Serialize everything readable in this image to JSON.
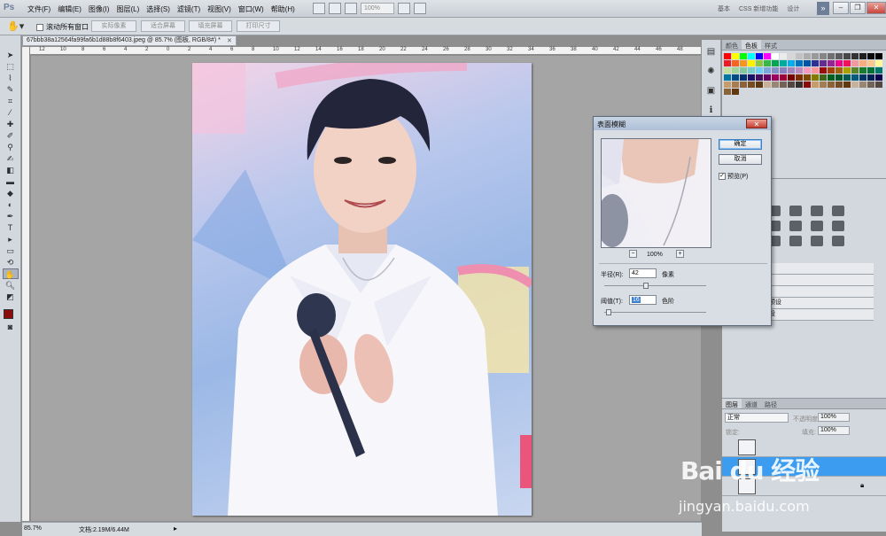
{
  "app": {
    "logo": "Ps",
    "menus": [
      "文件(F)",
      "编辑(E)",
      "图像(I)",
      "图层(L)",
      "选择(S)",
      "滤镜(T)",
      "视图(V)",
      "窗口(W)",
      "帮助(H)"
    ],
    "zoom_field": "100%",
    "workspaces": [
      "基本",
      "CSS 新增功能",
      "设计"
    ],
    "ws_arrow": "»"
  },
  "options": {
    "scroll_all": "滚动所有窗口",
    "buttons": [
      "实际像素",
      "适合屏幕",
      "填充屏幕",
      "打印尺寸"
    ]
  },
  "document": {
    "tab_title": "67bbb38a12564fa99fa6b1d88b8f6403.jpeg @ 85.7% (图板, RGB/8#) *",
    "ruler_ticks": [
      "12",
      "10",
      "8",
      "6",
      "4",
      "2",
      "0",
      "2",
      "4",
      "6",
      "8",
      "10",
      "12",
      "14",
      "16",
      "18",
      "20",
      "22",
      "24",
      "26",
      "28",
      "30",
      "32",
      "34",
      "36",
      "38",
      "40",
      "42",
      "44",
      "46",
      "48"
    ],
    "status_zoom": "85.7%",
    "status_info": "文档:2.19M/6.44M"
  },
  "dialog": {
    "title": "表面模糊",
    "ok": "确定",
    "cancel": "取消",
    "preview_label": "预览(P)",
    "preview_checked": true,
    "zoom": "100%",
    "radius_label": "半径(R):",
    "radius_value": "42",
    "radius_unit": "像素",
    "threshold_label": "阈值(T):",
    "threshold_value": "16",
    "threshold_unit": "色阶"
  },
  "panels": {
    "top_tabs": [
      "颜色",
      "色板",
      "样式"
    ],
    "adjust_rows": [
      "",
      "",
      "",
      "\"通道混和器\"预设",
      "\"可选颜色\"预设"
    ],
    "preset_partial": "\"预设",
    "layer_tabs": [
      "图层",
      "通道",
      "路径"
    ],
    "blend_mode": "正常",
    "opacity_label": "不透明度:",
    "opacity_value": "100%",
    "lock_label": "锁定:",
    "fill_label": "填充:",
    "fill_value": "100%"
  },
  "watermark": {
    "brand": "Bai du 经验",
    "url": "jingyan.baidu.com"
  },
  "colors": {
    "foreground": "#8b0a0a",
    "selection": "#3b9cf0"
  }
}
